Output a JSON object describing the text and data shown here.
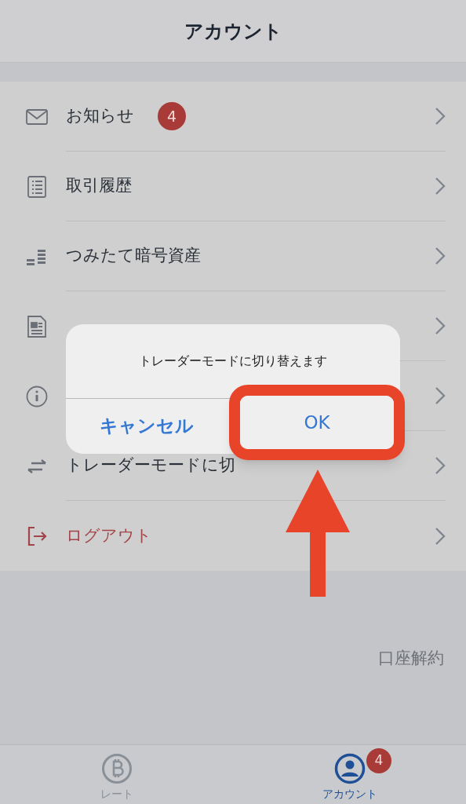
{
  "header": {
    "title": "アカウント"
  },
  "menu": [
    {
      "kind": "default",
      "label": "お知らせ",
      "badge": "4"
    },
    {
      "kind": "default",
      "label": "取引履歴"
    },
    {
      "kind": "default",
      "label": "つみたて暗号資産"
    },
    {
      "kind": "default"
    },
    {
      "kind": "default"
    },
    {
      "kind": "default",
      "label": "トレーダーモードに切"
    },
    {
      "kind": "destructive",
      "label": "ログアウト"
    }
  ],
  "footer_link": "口座解約",
  "tab_bar": [
    {
      "label": "レート",
      "selected": false
    },
    {
      "label": "アカウント",
      "selected": true,
      "badge": "4"
    }
  ],
  "dialog": {
    "message": "トレーダーモードに切り替えます",
    "buttons": [
      {
        "label": "キャンセル",
        "kind": "cancel"
      },
      {
        "label": "OK",
        "kind": "default"
      }
    ]
  }
}
